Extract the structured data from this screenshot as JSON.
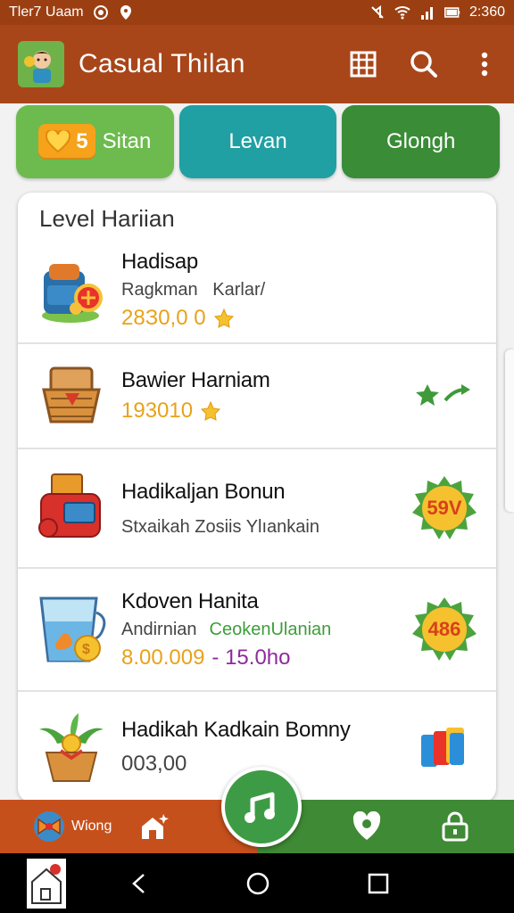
{
  "status_bar": {
    "left_text": "Tler7 Uaam",
    "time": "2:360"
  },
  "app_bar": {
    "title": "Casual Thilan",
    "actions": [
      "grid-icon",
      "search-icon",
      "more-vert-icon"
    ]
  },
  "tabs": [
    {
      "badge_count": "5",
      "label": "Sitan",
      "color": "#6dbb4e"
    },
    {
      "label": "Levan",
      "color": "#20a0a3"
    },
    {
      "label": "Glongh",
      "color": "#3a8c37"
    }
  ],
  "card": {
    "title": "Level Hariian",
    "items": [
      {
        "name": "Hadisap",
        "sub1": "Ragkman",
        "sub2": "Karlar/",
        "value": "28З0,0 0"
      },
      {
        "name": "Bawier Harniam",
        "value": "193010"
      },
      {
        "name": "Hadikaljan Bonun",
        "sub1": "Stxaikah Zosiis Ylıankain",
        "badge": "59V"
      },
      {
        "name": "Kdoven Hanita",
        "sub1": "Andirnian",
        "sub_green": "CeokenUlanian",
        "value": "8.00.009",
        "range": "- 15.0ho",
        "badge": "486"
      },
      {
        "name": "Hadikah Kadkain Bomny",
        "value": "003,00"
      }
    ]
  },
  "bottom_nav": {
    "left_label": "Wiong"
  },
  "colors": {
    "app_bar": "#a8461a",
    "accent_green": "#3e9b45",
    "accent_orange": "#c6501c",
    "gold": "#e8a21a"
  }
}
